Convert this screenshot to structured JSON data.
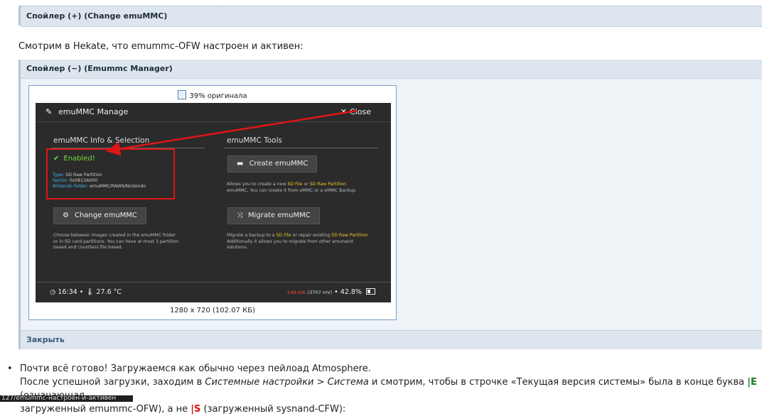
{
  "spoiler1": {
    "label": "Спойлер (+) (Change emuMMC)"
  },
  "intro": "Смотрим в Hekate, что emummc-OFW настроен и активен:",
  "spoiler2": {
    "label": "Спойлер (−) (Emummc Manager)",
    "close_label": "Закрыть"
  },
  "image": {
    "zoom_text": "39% оригинала",
    "size_text": "1280 x 720 (102.07 КБ)"
  },
  "screen": {
    "title": "emuMMC Manage",
    "close_label": "Close",
    "left_section": "emuMMC Info & Selection",
    "right_section": "emuMMC Tools",
    "enabled": "Enabled!",
    "info": {
      "type_key": "Type:",
      "type_val": "SD Raw Partition",
      "sector_key": "Sector:",
      "sector_val": "0x0813A000",
      "folder_key": "Nintendo folder:",
      "folder_val": "emuMMC/RAW9/Nintendo"
    },
    "create_button": "Create emuMMC",
    "create_desc": {
      "p1": "Allows you to create a new ",
      "sd_file": "SD File",
      "or": " or ",
      "sd_raw": "SD Raw Partition",
      "p2": "emuMMC. You can create it from eMMC or a eMMC Backup."
    },
    "change_button": "Change emuMMC",
    "change_desc": {
      "l1": "Choose between images created in the emuMMC folder",
      "l2": "or in SD card partitions. You can have at most 3 partition",
      "l3": "based and countless file based."
    },
    "migrate_button": "Migrate emuMMC",
    "migrate_desc": {
      "p1": "Migrate a backup to a ",
      "sd_file": "SD File",
      "p2": " or repair existing ",
      "sd_raw": "SD Raw Partition",
      "l2": "Additionally it allows you to migrate from other emunand",
      "l3": "solutions."
    },
    "footer": {
      "time": "16:34",
      "temp": "27.6 °C",
      "current": "-549 mA",
      "voltage": "(3707 mV)",
      "battery": "42.8%"
    },
    "colors": {
      "enabled": "#6fdc3a",
      "info_key": "#3fb6f0",
      "highlight": "#f0c92a",
      "annotation": "#e01515"
    }
  },
  "bullet": {
    "line1": "Почти всё готово! Загружаемся как обычно через пейлоад Atmosphere.",
    "l2_a": "После успешной загрузки, заходим в ",
    "l2_b": "Системные настройки > Система",
    "l2_c": " и смотрим, чтобы в строчке «Текущая версия системы» была в конце буква ",
    "l2_e": "|E",
    "l2_d": " (означающая",
    "l3_a": "загруженный emummc-OFW), а не ",
    "l3_s": "|S",
    "l3_b": " (загруженный sysnand-CFW):"
  },
  "status_url": "127/emummc-настроен-и-активен"
}
